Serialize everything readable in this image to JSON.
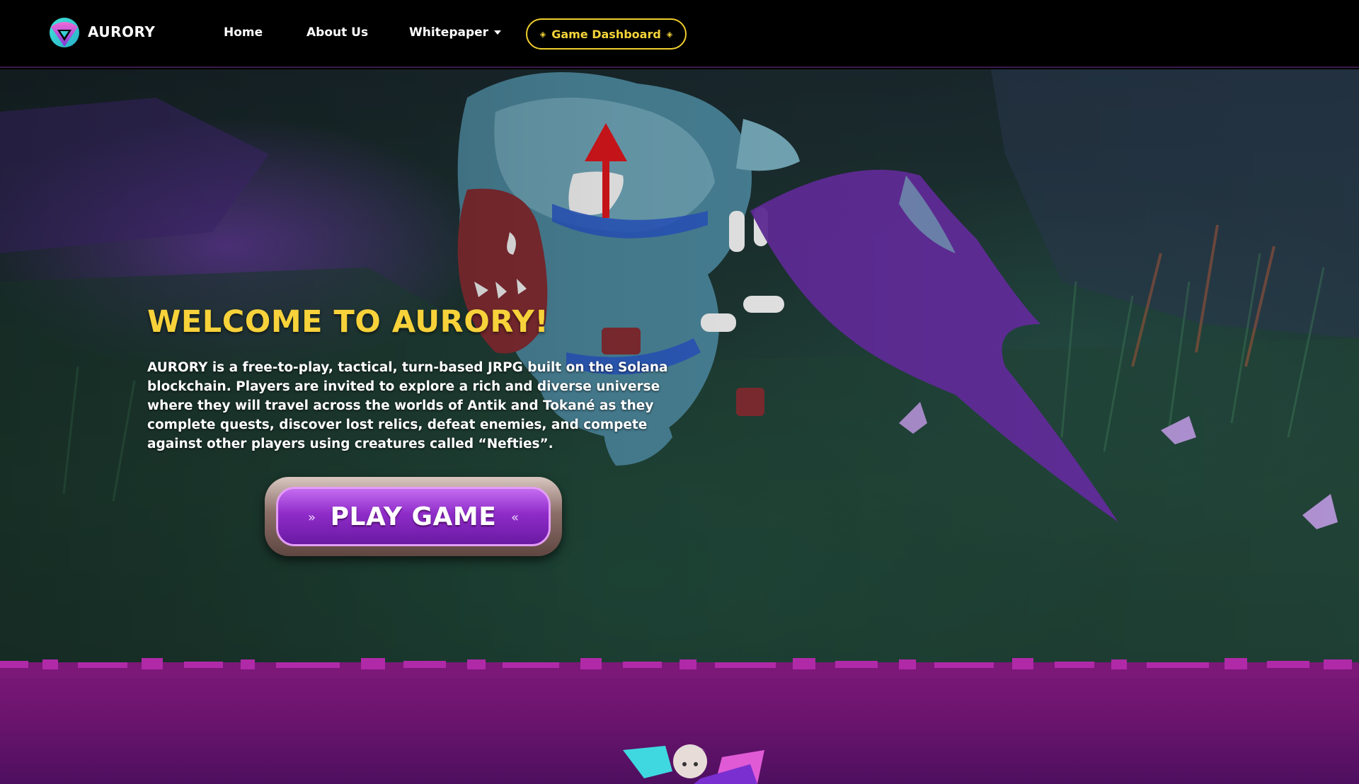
{
  "nav": {
    "brand": "AURORY",
    "links": [
      "Home",
      "About Us",
      "Whitepaper"
    ],
    "dashboard_label": "Game Dashboard"
  },
  "hero": {
    "title": "WELCOME TO AURORY!",
    "description": "AURORY is a free-to-play, tactical, turn-based JRPG built on the Solana blockchain. Players are invited to explore a rich and diverse universe where they will travel across the worlds of Antik and Tokané as they complete quests, discover lost relics, defeat enemies, and compete against other players using creatures called “Nefties”.",
    "play_label": "PLAY GAME"
  },
  "colors": {
    "accent_yellow": "#f4d43a",
    "annotation_red": "#e6181d",
    "button_purple": "#8f2cc9",
    "section_purple": "#7c1878"
  },
  "icons": [
    "aurory-logo-icon",
    "caret-down-icon",
    "diamond-icon",
    "chevron-right-icon",
    "chevron-left-icon"
  ]
}
